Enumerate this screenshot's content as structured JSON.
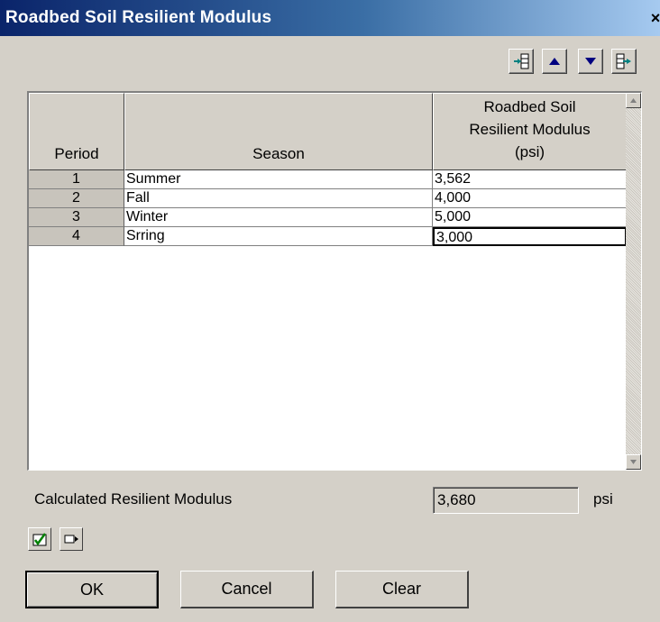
{
  "window": {
    "title": "Roadbed Soil Resilient Modulus",
    "close_glyph": "×"
  },
  "toolbar": {
    "buttons": [
      {
        "name": "insert-row-icon"
      },
      {
        "name": "move-up-icon"
      },
      {
        "name": "move-down-icon"
      },
      {
        "name": "append-row-icon"
      }
    ]
  },
  "table": {
    "headers": {
      "period": "Period",
      "season": "Season",
      "modulus_line1": "Roadbed Soil",
      "modulus_line2": "Resilient Modulus",
      "modulus_line3": "(psi)"
    },
    "rows": [
      {
        "period": "1",
        "season": "Summer",
        "modulus": "3,562"
      },
      {
        "period": "2",
        "season": "Fall",
        "modulus": "4,000"
      },
      {
        "period": "3",
        "season": "Winter",
        "modulus": "5,000"
      },
      {
        "period": "4",
        "season": "Srring",
        "modulus": "3,000"
      }
    ],
    "selected_row": 3
  },
  "calculated": {
    "label": "Calculated Resilient Modulus",
    "value": "3,680",
    "unit": "psi"
  },
  "buttons": {
    "ok": "OK",
    "cancel": "Cancel",
    "clear": "Clear"
  },
  "colors": {
    "title_gradient_start": "#0a246a",
    "title_gradient_end": "#a6caf0",
    "dialog_bg": "#d4d0c8"
  }
}
